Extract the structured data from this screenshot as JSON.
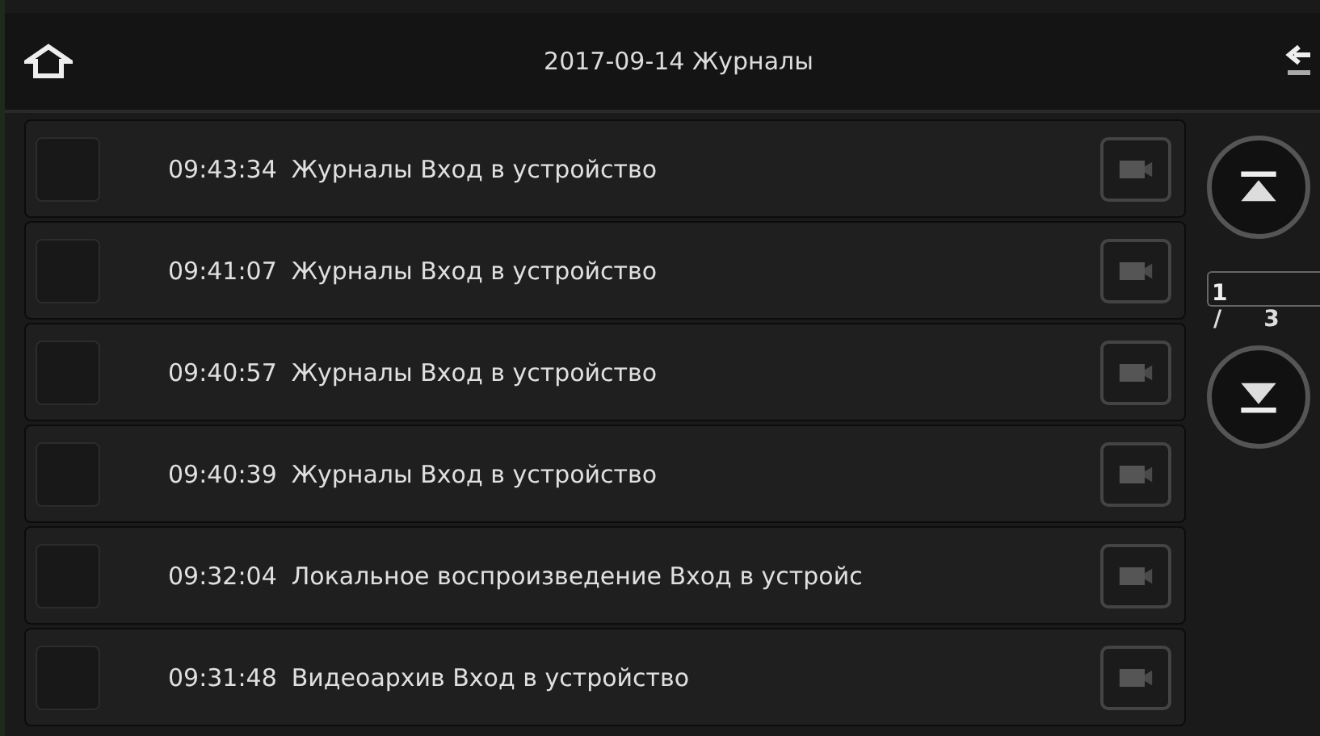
{
  "header": {
    "title": "2017-09-14  Журналы"
  },
  "logs": [
    {
      "checked": false,
      "time": "09:43:34",
      "event": "Журналы Вход в устройство"
    },
    {
      "checked": false,
      "time": "09:41:07",
      "event": "Журналы Вход в устройство"
    },
    {
      "checked": false,
      "time": "09:40:57",
      "event": "Журналы Вход в устройство"
    },
    {
      "checked": false,
      "time": "09:40:39",
      "event": "Журналы Вход в устройство"
    },
    {
      "checked": false,
      "time": "09:32:04",
      "event": "Локальное воспроизведение Вход в устройс"
    },
    {
      "checked": false,
      "time": "09:31:48",
      "event": "Видеоархив Вход в устройство"
    }
  ],
  "pager": {
    "current": "1",
    "separator": "/",
    "total": "3"
  }
}
